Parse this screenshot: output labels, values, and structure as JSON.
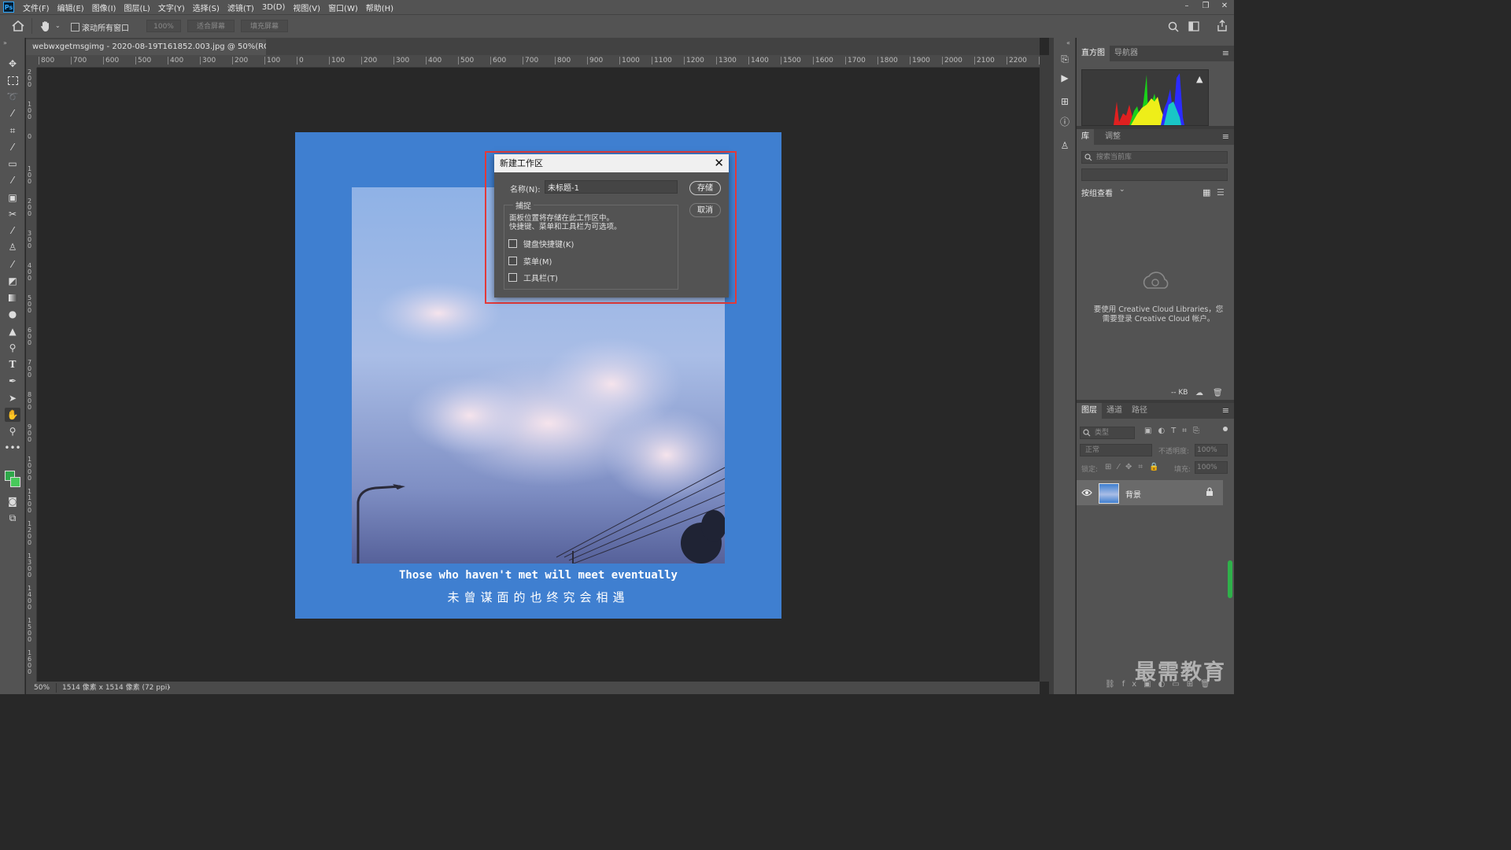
{
  "menubar": {
    "items": [
      "文件(F)",
      "编辑(E)",
      "图像(I)",
      "图层(L)",
      "文字(Y)",
      "选择(S)",
      "滤镜(T)",
      "3D(D)",
      "视图(V)",
      "窗口(W)",
      "帮助(H)"
    ],
    "app_logo": "Ps",
    "window_controls": [
      "–",
      "❐",
      "✕"
    ]
  },
  "options": {
    "scroll_all_windows": "滚动所有窗口",
    "zoom_value": "100%",
    "fit_screen": "适合屏幕",
    "fill_screen": "填充屏幕"
  },
  "document": {
    "tab_title": "webwxgetmsgimg - 2020-08-19T161852.003.jpg @ 50%(RGB/8*)",
    "tab_close": "×",
    "zoom": "50%",
    "dimensions": "1514 像素 x 1514 像素 (72 ppi)",
    "status_arrow": "›",
    "ruler_h_labels": [
      "800",
      "700",
      "600",
      "500",
      "400",
      "300",
      "200",
      "100",
      "0",
      "100",
      "200",
      "300",
      "400",
      "500",
      "600",
      "700",
      "800",
      "900",
      "1000",
      "1100",
      "1200",
      "1300",
      "1400",
      "1500",
      "1600",
      "1700",
      "1800",
      "1900",
      "2000",
      "2100",
      "2200",
      "2"
    ],
    "ruler_v_labels": [
      "200",
      "100",
      "0",
      "100",
      "200",
      "300",
      "400",
      "500",
      "600",
      "700",
      "800",
      "900",
      "1000",
      "1100",
      "1200",
      "1300",
      "1400",
      "1500",
      "1600",
      "1700"
    ]
  },
  "artwork": {
    "caption_en": "Those who haven't met will meet eventually",
    "caption_zh": "未曾谋面的也终究会相遇"
  },
  "dialog": {
    "title": "新建工作区",
    "close": "✕",
    "name_label": "名称(N):",
    "name_value": "未标题-1",
    "save_button": "存储",
    "cancel_button": "取消",
    "capture_title": "捕捉",
    "capture_desc_line1": "面板位置将存储在此工作区中。",
    "capture_desc_line2": "快捷键、菜单和工具栏为可选项。",
    "check_shortcuts": "键盘快捷键(K)",
    "check_menus": "菜单(M)",
    "check_toolbar": "工具栏(T)"
  },
  "panels": {
    "tab_histogram": "直方图",
    "tab_navigator": "导航器",
    "tab_library": "库",
    "tab_adjustments": "调整",
    "library_search_placeholder": "搜索当前库",
    "group_view": "按组查看",
    "cc_message_line1": "要使用 Creative Cloud Libraries，您",
    "cc_message_line2": "需要登录 Creative Cloud 帐户。",
    "library_size": "-- KB",
    "tab_layers": "图层",
    "tab_channels": "通道",
    "tab_paths": "路径",
    "layer_filter": "类型",
    "blend_mode": "正常",
    "opacity_label": "不透明度:",
    "opacity_value": "100%",
    "lock_label": "锁定:",
    "fill_label": "填充:",
    "fill_value": "100%",
    "layer_name": "背景"
  },
  "watermark": "最需教育",
  "colors": {
    "foreground": "#2fa84a",
    "background": "#47c95a",
    "highlight_box": "#e23b3b",
    "artwork_bg": "#3f7fd0"
  },
  "icons": {
    "home": "home-icon",
    "hand": "hand-tool-icon",
    "search": "search-icon",
    "visibility": "eye-icon",
    "lock": "lock-icon"
  }
}
